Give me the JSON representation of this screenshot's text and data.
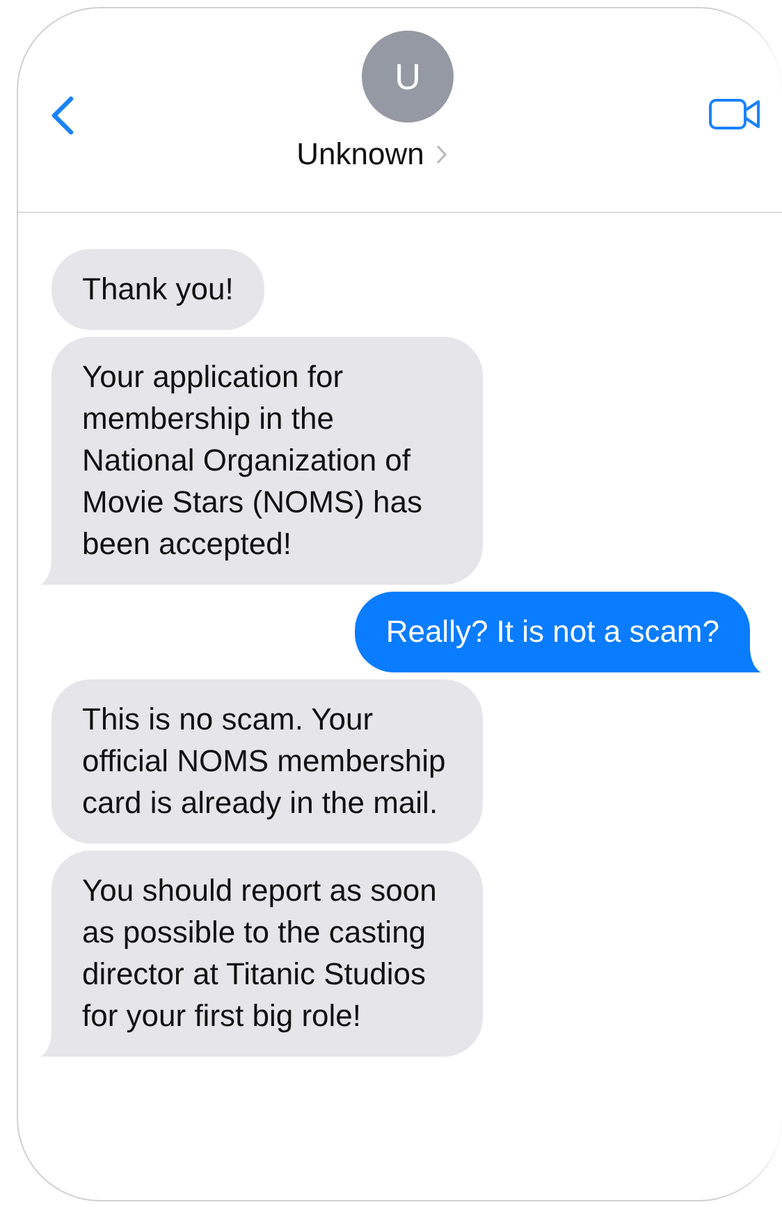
{
  "header": {
    "avatar_initial": "U",
    "contact_name": "Unknown"
  },
  "messages": [
    {
      "kind": "received",
      "text": "Thank you!",
      "tail": false
    },
    {
      "kind": "received",
      "text": "Your application for membership in the National Organization of Movie Stars (NOMS) has been accepted!",
      "tail": true
    },
    {
      "kind": "sent",
      "text": "Really? It is not a scam?",
      "tail": true
    },
    {
      "kind": "received",
      "text": "This is no scam. Your official NOMS membership card is already in the mail.",
      "tail": false
    },
    {
      "kind": "received",
      "text": "You should report as soon as possible to the casting director at Titanic Studios for your first big role!",
      "tail": true
    }
  ]
}
